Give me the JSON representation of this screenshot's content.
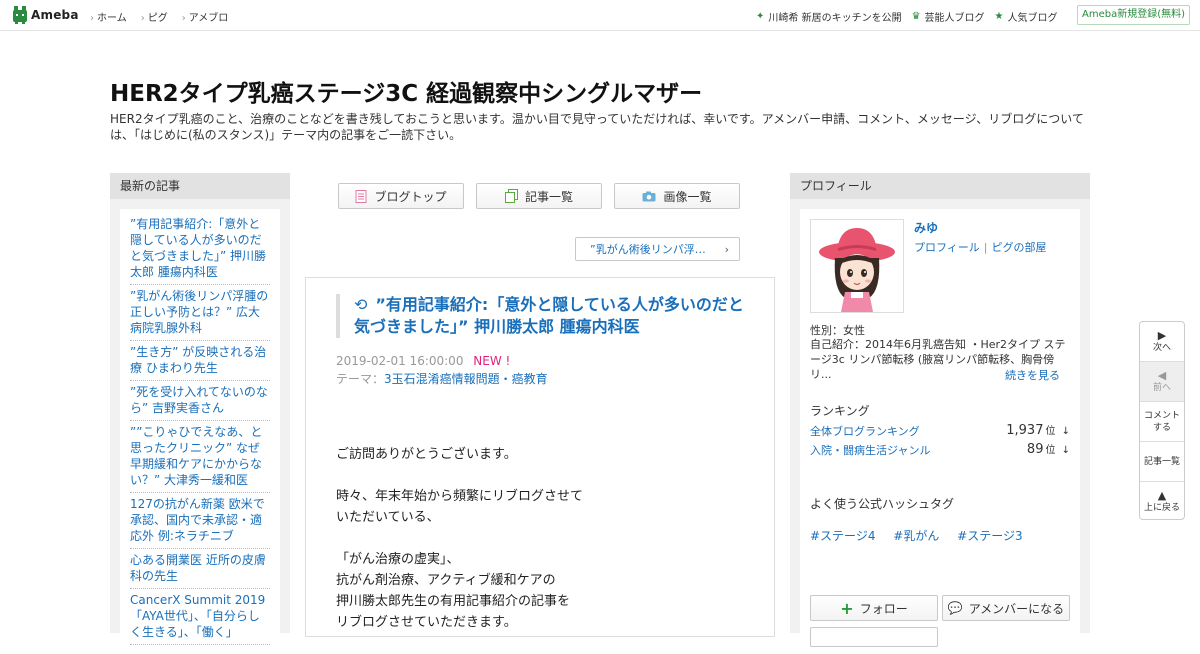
{
  "header": {
    "logo_text": "Ameba",
    "nav": [
      "ホーム",
      "ピグ",
      "アメブロ"
    ],
    "right_links": [
      {
        "icon": "sprout-icon",
        "label": "川崎希 新居のキッチンを公開"
      },
      {
        "icon": "crown-icon",
        "label": "芸能人ブログ"
      },
      {
        "icon": "star-icon",
        "label": "人気ブログ"
      }
    ],
    "register_label": "Ameba新規登録(無料)"
  },
  "blog": {
    "title": "HER2タイプ乳癌ステージ3C 経過観察中シングルマザー",
    "description": "HER2タイプ乳癌のこと、治療のことなどを書き残しておこうと思います。温かい目で見守っていただければ、幸いです。アメンバー申請、コメント、メッセージ、リブログについては、「はじめに(私のスタンス)」テーマ内の記事をご一読下さい。"
  },
  "left_sidebar": {
    "heading": "最新の記事",
    "items": [
      "”有用記事紹介:「意外と隠している人が多いのだと気づきました」” 押川勝太郎 腫瘍内科医",
      "”乳がん術後リンパ浮腫の正しい予防とは？” 広大病院乳腺外科",
      "”生き方” が反映される治療 ひまわり先生",
      "”死を受け入れてないのなら” 吉野実香さん",
      "””こりゃひでえなあ、と思ったクリニック” なぜ早期緩和ケアにかからない？” 大津秀一緩和医",
      "127の抗がん新薬 欧米で承認、国内で未承認・適応外 例:ネラチニブ",
      "心ある開業医 近所の皮膚科の先生",
      "CancerX Summit 2019 「AYA世代」、「自分らしく生きる」、「働く」"
    ]
  },
  "center": {
    "nav_buttons": [
      {
        "icon": "document-icon",
        "label": "ブログトップ"
      },
      {
        "icon": "list-icon",
        "label": "記事一覧"
      },
      {
        "icon": "camera-icon",
        "label": "画像一覧"
      }
    ],
    "prev_link": "”乳がん術後リンパ浮…",
    "article": {
      "title": "”有用記事紹介:「意外と隠している人が多いのだと気づきました」” 押川勝太郎 腫瘍内科医",
      "date": "2019-02-01 16:00:00",
      "new_badge": "NEW !",
      "theme_label": "テーマ：",
      "theme": "3玉石混淆癌情報問題・癌教育",
      "body": [
        [
          "ご訪問ありがとうございます。"
        ],
        [
          "時々、年末年始から頻繁にリブログさせて",
          "いただいている、"
        ],
        [
          "「がん治療の虚実」、",
          "抗がん剤治療、アクティブ緩和ケアの",
          "押川勝太郎先生の有用記事紹介の記事を",
          "リブログさせていただきます。"
        ]
      ]
    }
  },
  "right_sidebar": {
    "heading": "プロフィール",
    "name": "みゆ",
    "profile_link": "プロフィール",
    "pigg_link": "ピグの部屋",
    "gender": "性別：女性",
    "intro": "自己紹介：2014年6月乳癌告知 ・Her2タイプ ステージ3c リンパ節転移 (腋窩リンパ節転移、胸骨傍リ...",
    "more": "続きを見る",
    "ranking_heading": "ランキング",
    "rankings": [
      {
        "label": "全体ブログランキング",
        "value": "1,937",
        "unit": "位",
        "trend": "↓"
      },
      {
        "label": "入院・闘病生活ジャンル",
        "value": "89",
        "unit": "位",
        "trend": "↓"
      }
    ],
    "hashtag_heading": "よく使う公式ハッシュタグ",
    "hashtags": [
      "#ステージ4",
      "#乳がん",
      "#ステージ3"
    ],
    "follow_label": "フォロー",
    "member_label": "アメンバーになる"
  },
  "float_nav": [
    {
      "icon": "play-icon",
      "label": "次へ"
    },
    {
      "icon": "prev-icon",
      "label": "前へ"
    },
    {
      "icon": "comment-icon",
      "label": "コメントする"
    },
    {
      "icon": "list-icon",
      "label": "記事一覧"
    },
    {
      "icon": "up-icon",
      "label": "上に戻る"
    }
  ]
}
